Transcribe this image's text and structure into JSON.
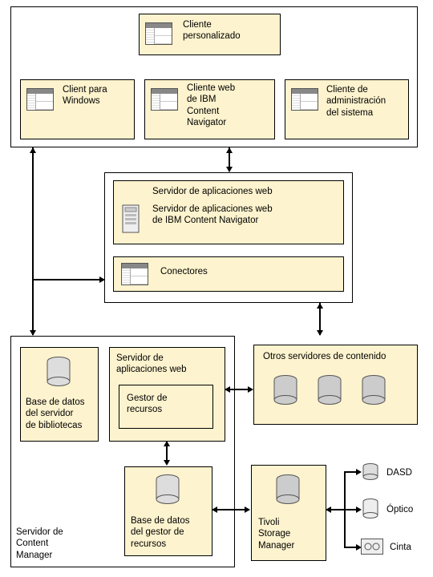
{
  "clients": {
    "custom": "Cliente\npersonalizado",
    "windows": "Client para\nWindows",
    "navigator": "Cliente web\nde IBM\nContent\nNavigator",
    "admin": "Cliente de\nadministración\ndel sistema"
  },
  "web_app_server": {
    "title": "Servidor de aplicaciones web",
    "subtitle": "Servidor de aplicaciones web\nde IBM Content Navigator",
    "connectors": "Conectores"
  },
  "content_manager": {
    "frame_label": "Servidor de\nContent\nManager",
    "library_db": "Base de datos\ndel servidor\nde bibliotecas",
    "app_server": "Servidor de\naplicaciones web",
    "resource_mgr": "Gestor de\nrecursos",
    "rm_db": "Base de datos\ndel gestor de\nrecursos"
  },
  "other_servers": "Otros servidores de contenido",
  "tsm": {
    "label": "Tivoli\nStorage\nManager",
    "storage": {
      "dasd": "DASD",
      "optical": "Óptico",
      "tape": "Cinta"
    }
  }
}
